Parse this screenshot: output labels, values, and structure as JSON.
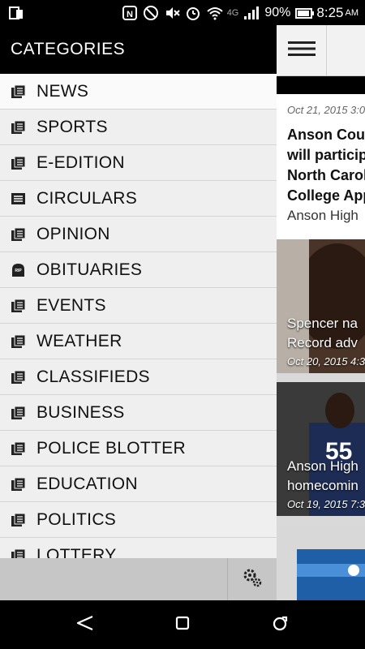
{
  "status_bar": {
    "battery": "90%",
    "time": "8:25",
    "ampm": "AM",
    "network": "4G"
  },
  "drawer": {
    "title": "CATEGORIES",
    "items": [
      {
        "label": "NEWS",
        "icon": "newspaper-icon"
      },
      {
        "label": "SPORTS",
        "icon": "newspaper-icon"
      },
      {
        "label": "E-EDITION",
        "icon": "newspaper-icon"
      },
      {
        "label": "CIRCULARS",
        "icon": "circular-icon"
      },
      {
        "label": "OPINION",
        "icon": "newspaper-icon"
      },
      {
        "label": "OBITUARIES",
        "icon": "rip-icon"
      },
      {
        "label": "EVENTS",
        "icon": "newspaper-icon"
      },
      {
        "label": "WEATHER",
        "icon": "newspaper-icon"
      },
      {
        "label": "CLASSIFIEDS",
        "icon": "newspaper-icon"
      },
      {
        "label": "BUSINESS",
        "icon": "newspaper-icon"
      },
      {
        "label": "POLICE BLOTTER",
        "icon": "newspaper-icon"
      },
      {
        "label": "EDUCATION",
        "icon": "newspaper-icon"
      },
      {
        "label": "POLITICS",
        "icon": "newspaper-icon"
      },
      {
        "label": "LOTTERY",
        "icon": "newspaper-icon"
      }
    ]
  },
  "content": {
    "article1": {
      "date": "Oct 21, 2015 3:0",
      "title_lines": [
        "Anson Coun",
        "will particip",
        "North Carol",
        "College App"
      ],
      "subtitle": "Anson High"
    },
    "card2": {
      "title_lines": [
        "Spencer na",
        "Record adv"
      ],
      "date": "Oct 20, 2015 4:3"
    },
    "card3": {
      "title_lines": [
        "Anson High",
        "homecomin"
      ],
      "date": "Oct 19, 2015 7:3"
    }
  },
  "colors": {
    "header_bg": "#000000",
    "drawer_bg": "#efefef",
    "footer_bg": "#c6c6c6"
  }
}
